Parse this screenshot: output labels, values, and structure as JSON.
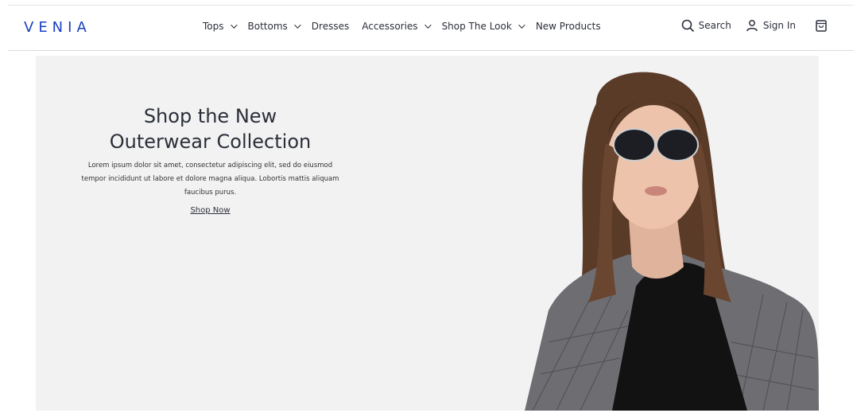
{
  "header": {
    "logo": "VENIA",
    "nav": [
      {
        "label": "Tops",
        "has_dropdown": true
      },
      {
        "label": "Bottoms",
        "has_dropdown": true
      },
      {
        "label": "Dresses",
        "has_dropdown": false
      },
      {
        "label": "Accessories",
        "has_dropdown": true
      },
      {
        "label": "Shop The Look",
        "has_dropdown": true
      },
      {
        "label": "New Products",
        "has_dropdown": false
      }
    ],
    "search_label": "Search",
    "signin_label": "Sign In",
    "icons": {
      "search": "search-icon",
      "user": "user-icon",
      "cart": "shopping-bag-icon"
    }
  },
  "hero": {
    "title_line1": "Shop the New",
    "title_line2": "Outerwear Collection",
    "description": "Lorem ipsum dolor sit amet, consectetur adipiscing elit, sed do eiusmod tempor incididunt ut labore et dolore magna aliqua. Lobortis mattis aliquam faucibus purus.",
    "cta_label": "Shop Now"
  },
  "colors": {
    "background": "#f2f2f2",
    "text": "#2b2f3a",
    "logo_accent": "#1b3fbf"
  }
}
